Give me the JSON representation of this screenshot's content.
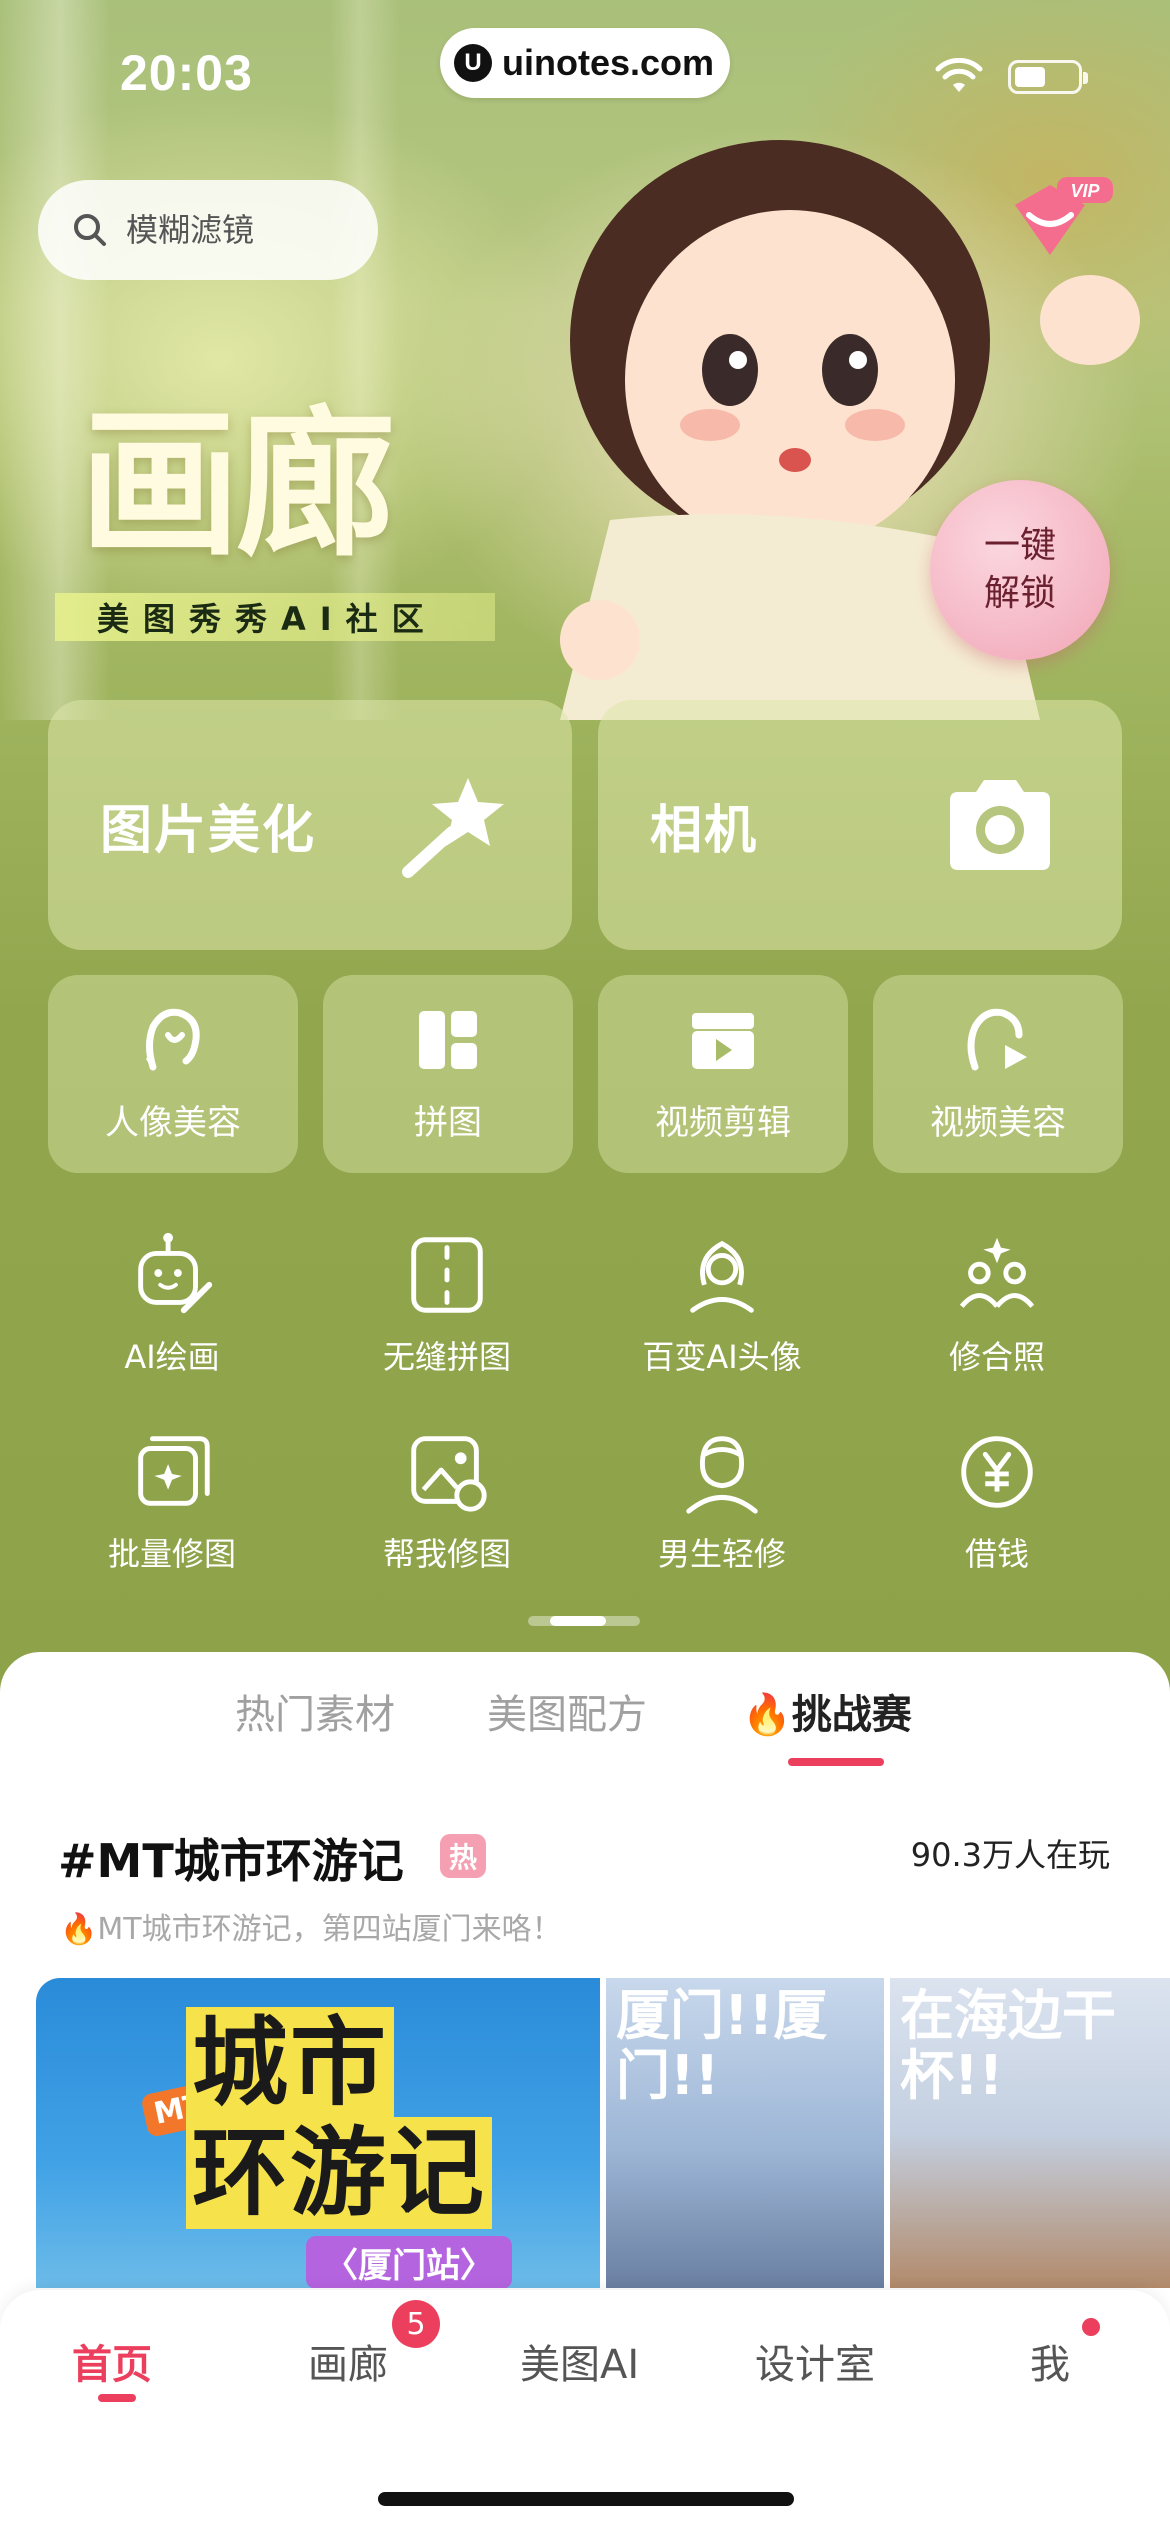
{
  "status_bar": {
    "time": "20:03",
    "url": "uinotes.com",
    "url_logo": "U"
  },
  "search": {
    "placeholder": "模糊滤镜"
  },
  "hero": {
    "logo_text": "画廊",
    "subtitle": "美图秀秀AI社区",
    "vip_label": "VIP",
    "unlock_line1": "一键",
    "unlock_line2": "解锁"
  },
  "main_cards": [
    {
      "label": "图片美化",
      "icon": "magic-wand-icon"
    },
    {
      "label": "相机",
      "icon": "camera-icon"
    }
  ],
  "feature_cards": [
    {
      "label": "人像美容",
      "icon": "portrait-icon"
    },
    {
      "label": "拼图",
      "icon": "collage-icon"
    },
    {
      "label": "视频剪辑",
      "icon": "video-edit-icon"
    },
    {
      "label": "视频美容",
      "icon": "video-beauty-icon"
    }
  ],
  "tools_row1": [
    {
      "label": "AI绘画",
      "icon": "robot-paint-icon"
    },
    {
      "label": "无缝拼图",
      "icon": "seamless-collage-icon"
    },
    {
      "label": "百变AI头像",
      "icon": "ai-avatar-icon"
    },
    {
      "label": "修合照",
      "icon": "group-photo-icon"
    }
  ],
  "tools_row2": [
    {
      "label": "批量修图",
      "icon": "batch-edit-icon"
    },
    {
      "label": "帮我修图",
      "icon": "help-edit-icon"
    },
    {
      "label": "男生轻修",
      "icon": "male-retouch-icon"
    },
    {
      "label": "借钱",
      "icon": "yuan-icon"
    }
  ],
  "content_tabs": [
    "热门素材",
    "美图配方",
    "挑战赛"
  ],
  "active_tab": "挑战赛",
  "challenge": {
    "title": "#MT城市环游记",
    "hot_label": "热",
    "players": "90.3万人在玩",
    "description": "MT城市环游记，第四站厦门来咯！",
    "thumb_main_line1": "城市",
    "thumb_main_line2": "环游记",
    "thumb_main_badge": "MT",
    "thumb_main_station": "〈厦门站〉",
    "thumb2_text": "厦门!!厦门!!",
    "thumb3_text": "在海边干杯!!"
  },
  "bottom_nav": [
    {
      "label": "首页"
    },
    {
      "label": "画廊"
    },
    {
      "label": "美图AI"
    },
    {
      "label": "设计室"
    },
    {
      "label": "我"
    }
  ],
  "nav_badge_count": "5",
  "colors": {
    "accent": "#ec3f5e",
    "panel_green": "#8ea24a"
  }
}
